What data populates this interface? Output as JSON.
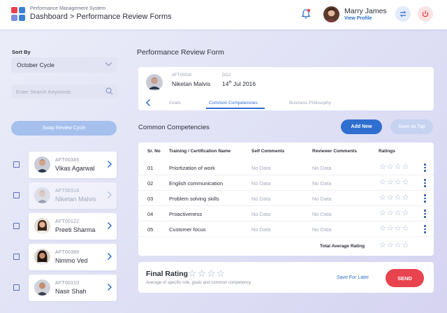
{
  "header": {
    "app_name": "Performance Management System",
    "breadcrumb": "Dashboard > Performance Review Forms",
    "user_name": "Marry James",
    "view_profile": "View Profile",
    "logo_colors": [
      "#e8434e",
      "#3b82d6",
      "#7b8fe0",
      "#3b82d6"
    ]
  },
  "sidebar": {
    "sort_label": "Sort By",
    "sort_value": "October Cycle",
    "search_placeholder": "Enter Search Keywords",
    "swap_button": "Swap Review Cycle",
    "employees": [
      {
        "id": "AFT00345",
        "name": "Vikas Agarwal",
        "dim": false
      },
      {
        "id": "AFT00318",
        "name": "Niketan Malvis",
        "dim": true
      },
      {
        "id": "AFT00122",
        "name": "Preeti Sharma",
        "dim": false
      },
      {
        "id": "AFT00389",
        "name": "Nimmo Ved",
        "dim": false
      },
      {
        "id": "AFT00310",
        "name": "Nasir Shah",
        "dim": false
      }
    ]
  },
  "form": {
    "title": "Performance Review Form",
    "employee_id": "AFT00318",
    "employee_name": "Niketan Malvis",
    "doj_label": "DOJ",
    "doj_day": "14",
    "doj_suffix": "th",
    "doj_rest": " Jul 2016",
    "tabs": [
      "Goals",
      "Common Competencies",
      "Business Philosophy"
    ],
    "active_tab": "Common Competencies"
  },
  "competencies": {
    "title": "Common Competencies",
    "add_button": "Add New",
    "save_tap_button": "Save as Tap",
    "headers": {
      "sr": "Sr. No",
      "name": "Training / Certification Name",
      "self": "Self Comments",
      "reviewer": "Reviewer Comments",
      "ratings": "Ratings"
    },
    "rows": [
      {
        "sr": "01",
        "name": "Priortization of work",
        "self": "No Data",
        "reviewer": "No Data",
        "rating": 0
      },
      {
        "sr": "02",
        "name": "English communication",
        "self": "No Data",
        "reviewer": "No Data",
        "rating": 0
      },
      {
        "sr": "03",
        "name": "Problem solving skills",
        "self": "No Data",
        "reviewer": "No Data",
        "rating": 0
      },
      {
        "sr": "04",
        "name": "Proactiveness",
        "self": "No Data",
        "reviewer": "No Data",
        "rating": 0
      },
      {
        "sr": "05",
        "name": "Customer focus",
        "self": "No Data",
        "reviewer": "No Data",
        "rating": 0
      }
    ],
    "total_label": "Total Average Rating",
    "total_rating": 0
  },
  "final": {
    "title": "Final Rating",
    "subtitle": "Average of specific role, goals and common competency",
    "rating": 0,
    "save_later": "Save For Later",
    "send": "SEND"
  },
  "colors": {
    "primary": "#2f6fcf",
    "danger": "#e8434e",
    "star": "#9fb0cc"
  }
}
